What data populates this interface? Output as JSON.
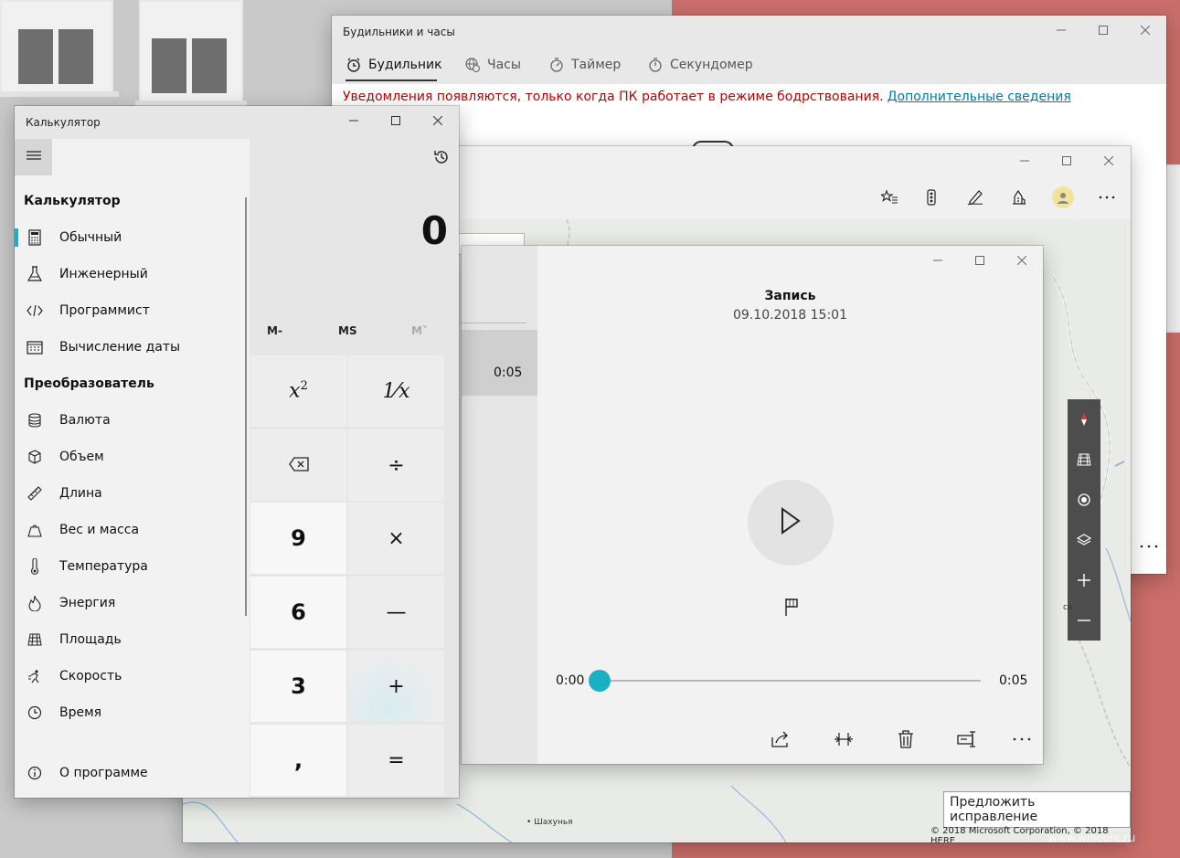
{
  "alarms": {
    "title": "Будильники и часы",
    "tabs": [
      {
        "label": "Будильник",
        "icon": "alarm-clock-icon"
      },
      {
        "label": "Часы",
        "icon": "world-clock-icon"
      },
      {
        "label": "Таймер",
        "icon": "timer-icon"
      },
      {
        "label": "Секундомер",
        "icon": "stopwatch-icon"
      }
    ],
    "notice": "Уведомления появляются, только когда ПК работает в режиме бодрствования.",
    "notice_link": "Дополнительные сведения"
  },
  "maps": {
    "toolbar_icons": [
      "favorites-icon",
      "traffic-icon",
      "ink-icon",
      "3d-cities-icon",
      "account-icon",
      "more-icon"
    ],
    "suggest_label": "Предложить исправление",
    "copyright": "© 2018 Microsoft Corporation, © 2018 HERE",
    "place_label": "Шахунья",
    "place_label_partial": "ск"
  },
  "recorder": {
    "item_duration": "0:05",
    "title": "Запись",
    "date": "09.10.2018 15:01",
    "time_start": "0:00",
    "time_end": "0:05",
    "progress": 0
  },
  "calculator": {
    "title": "Калькулятор",
    "section_calc": "Калькулятор",
    "modes": [
      {
        "label": "Обычный",
        "icon": "calculator-icon"
      },
      {
        "label": "Инженерный",
        "icon": "flask-icon"
      },
      {
        "label": "Программист",
        "icon": "code-icon"
      },
      {
        "label": "Вычисление даты",
        "icon": "calendar-icon"
      }
    ],
    "section_conv": "Преобразователь",
    "converters": [
      {
        "label": "Валюта",
        "icon": "currency-icon"
      },
      {
        "label": "Объем",
        "icon": "cube-icon"
      },
      {
        "label": "Длина",
        "icon": "ruler-icon"
      },
      {
        "label": "Вес и масса",
        "icon": "weight-icon"
      },
      {
        "label": "Температура",
        "icon": "thermometer-icon"
      },
      {
        "label": "Энергия",
        "icon": "flame-icon"
      },
      {
        "label": "Площадь",
        "icon": "area-icon"
      },
      {
        "label": "Скорость",
        "icon": "speed-icon"
      },
      {
        "label": "Время",
        "icon": "clock-icon"
      }
    ],
    "about": "О программе",
    "display_value": "0",
    "memory": [
      "M-",
      "MS",
      "M˅"
    ],
    "keys_right": [
      "1⁄x",
      "÷",
      "×",
      "—",
      "+",
      "="
    ],
    "keys_left": [
      "⌫",
      "9",
      "6",
      "3",
      ","
    ]
  },
  "watermark": "www.wincore.ru"
}
